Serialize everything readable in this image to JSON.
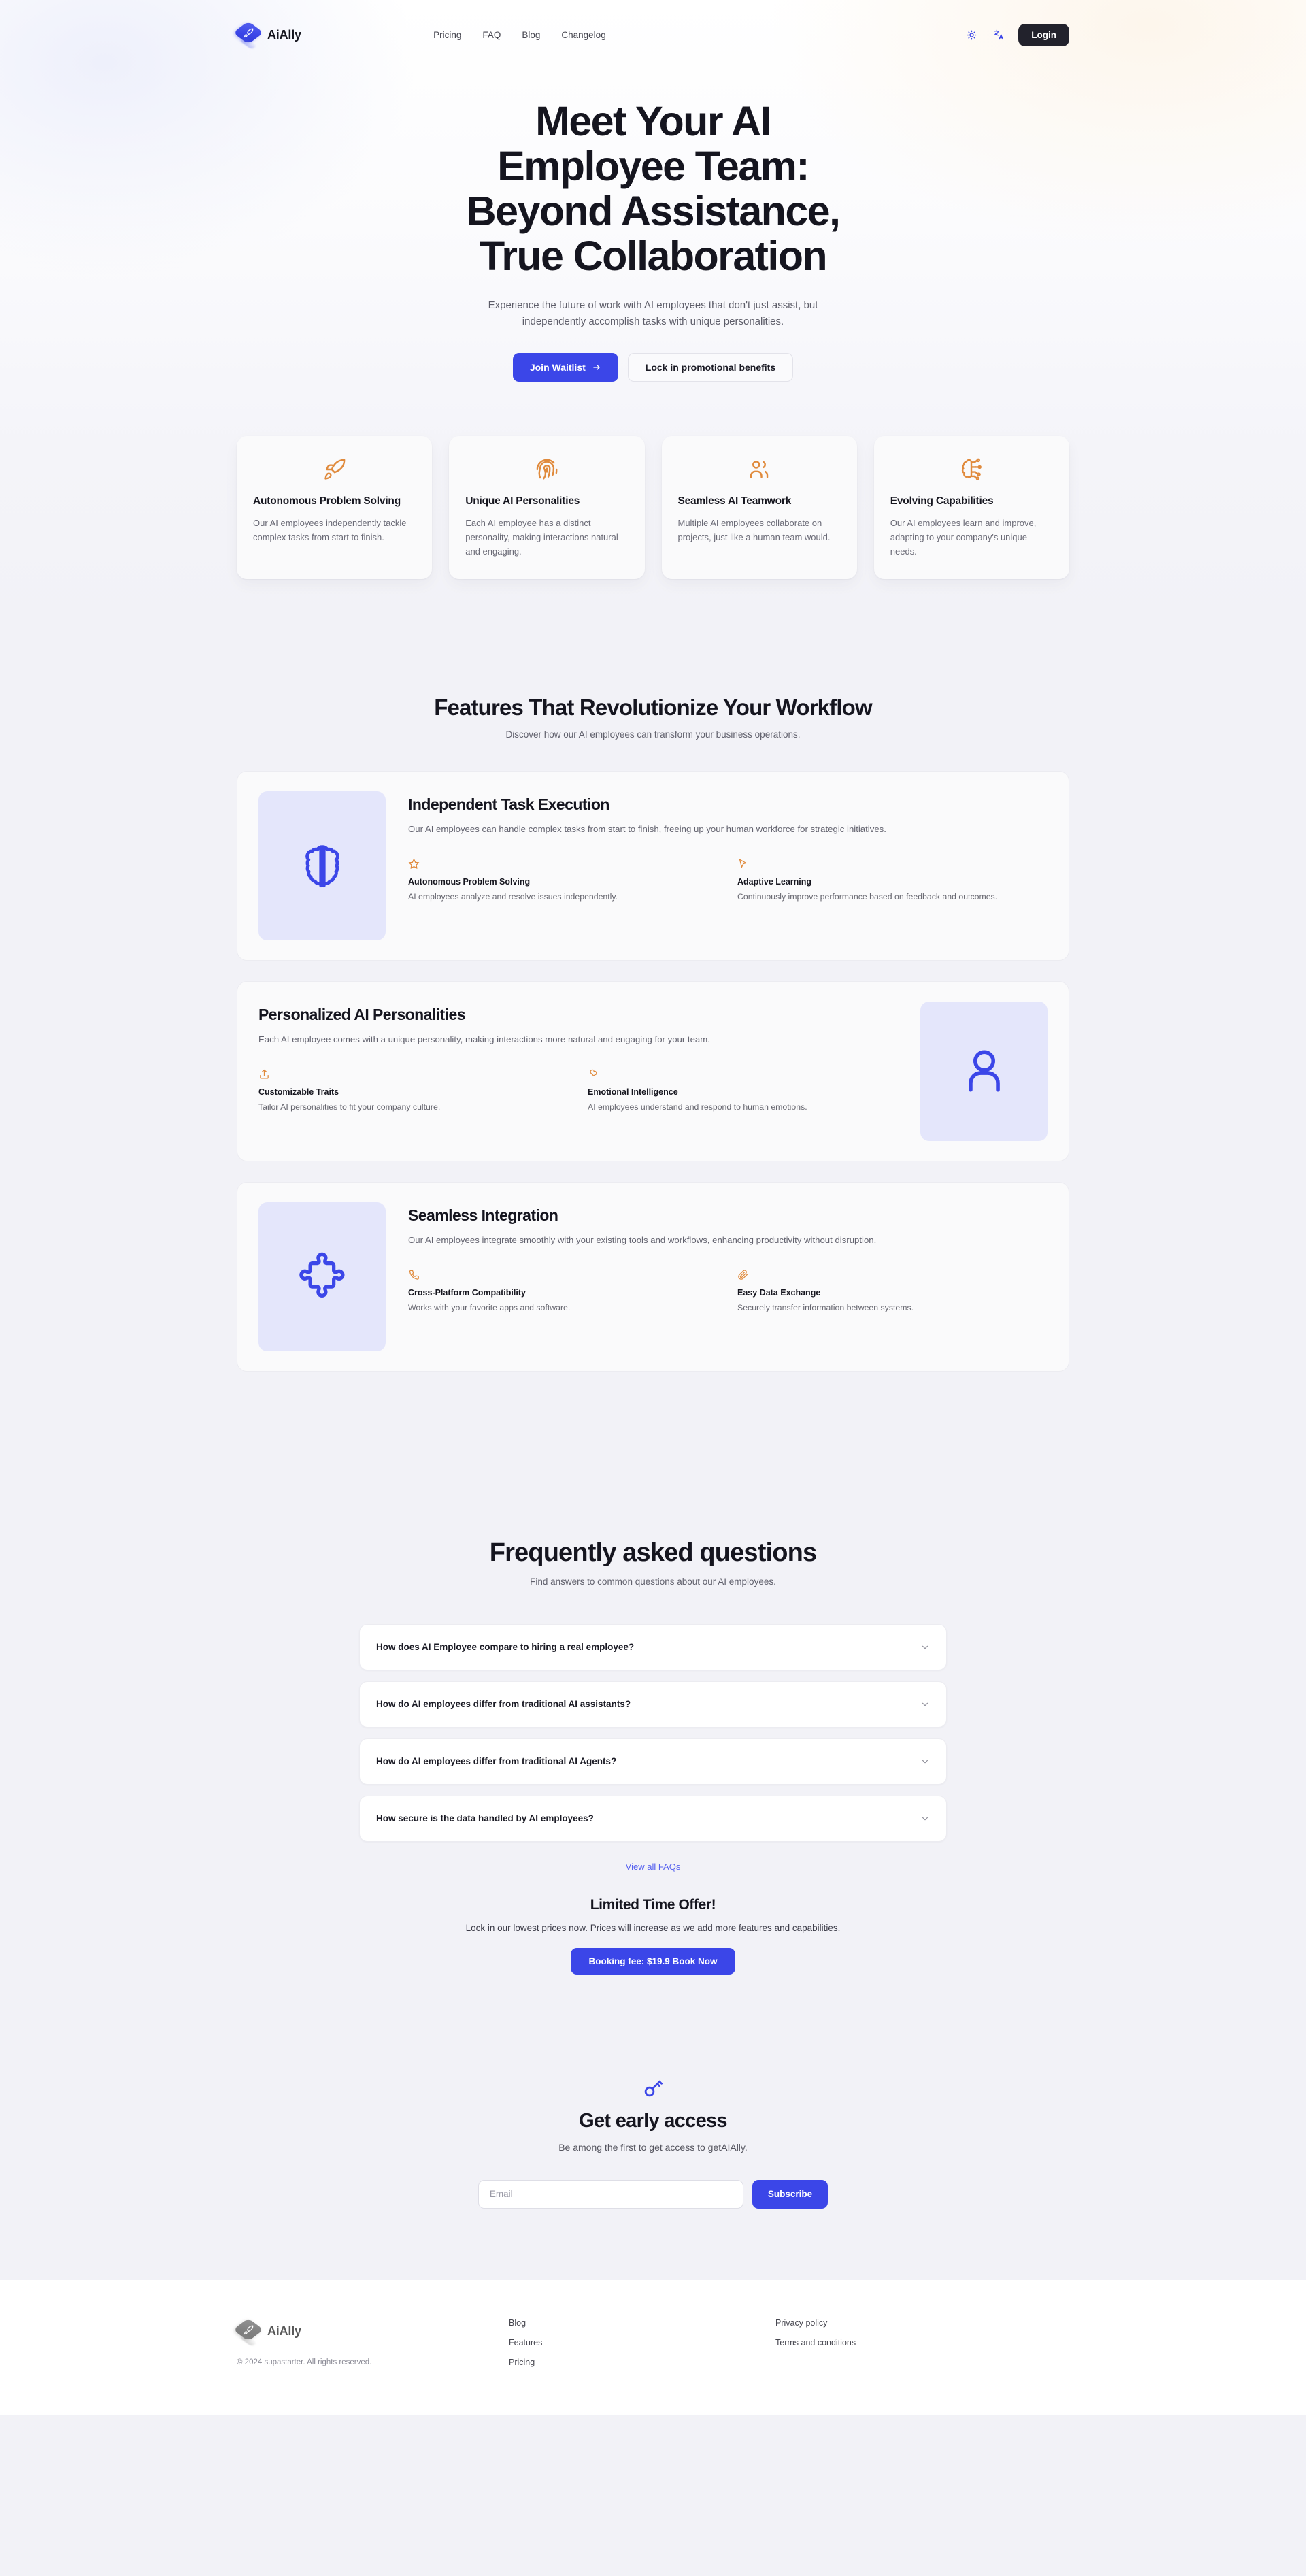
{
  "header": {
    "brand": "AiAlly",
    "logo_icon": "rocket-diamond-logo",
    "nav": [
      {
        "label": "Pricing"
      },
      {
        "label": "FAQ"
      },
      {
        "label": "Blog"
      },
      {
        "label": "Changelog"
      }
    ],
    "theme_toggle_icon": "sun-icon",
    "language_icon": "translate-icon",
    "login_label": "Login"
  },
  "hero": {
    "title_lines": [
      "Meet Your AI",
      "Employee Team:",
      "Beyond Assistance,",
      "True Collaboration"
    ],
    "subtitle": "Experience the future of work with AI employees that don't just assist, but independently accomplish tasks with unique personalities.",
    "primary_cta": "Join Waitlist",
    "primary_cta_icon": "arrow-right-icon",
    "secondary_cta": "Lock in promotional benefits"
  },
  "benefits": [
    {
      "icon": "rocket-icon",
      "title": "Autonomous Problem Solving",
      "desc": "Our AI employees independently tackle complex tasks from start to finish."
    },
    {
      "icon": "fingerprint-icon",
      "title": "Unique AI Personalities",
      "desc": "Each AI employee has a distinct personality, making interactions natural and engaging."
    },
    {
      "icon": "users-icon",
      "title": "Seamless AI Teamwork",
      "desc": "Multiple AI employees collaborate on projects, just like a human team would."
    },
    {
      "icon": "brain-circuit-icon",
      "title": "Evolving Capabilities",
      "desc": "Our AI employees learn and improve, adapting to your company's unique needs."
    }
  ],
  "features_section": {
    "title": "Features That Revolutionize Your Workflow",
    "subtitle": "Discover how our AI employees can transform your business operations.",
    "cards": [
      {
        "media_icon": "brain-icon",
        "title": "Independent Task Execution",
        "desc": "Our AI employees can handle complex tasks from start to finish, freeing up your human workforce for strategic initiatives.",
        "subs": [
          {
            "icon": "star-icon",
            "title": "Autonomous Problem Solving",
            "desc": "AI employees analyze and resolve issues independently."
          },
          {
            "icon": "cursor-icon",
            "title": "Adaptive Learning",
            "desc": "Continuously improve performance based on feedback and outcomes."
          }
        ]
      },
      {
        "media_icon": "user-icon",
        "title": "Personalized AI Personalities",
        "desc": "Each AI employee comes with a unique personality, making interactions more natural and engaging for your team.",
        "subs": [
          {
            "icon": "upload-icon",
            "title": "Customizable Traits",
            "desc": "Tailor AI personalities to fit your company culture."
          },
          {
            "icon": "heart-hand-icon",
            "title": "Emotional Intelligence",
            "desc": "AI employees understand and respond to human emotions."
          }
        ]
      },
      {
        "media_icon": "puzzle-icon",
        "title": "Seamless Integration",
        "desc": "Our AI employees integrate smoothly with your existing tools and workflows, enhancing productivity without disruption.",
        "subs": [
          {
            "icon": "phone-icon",
            "title": "Cross-Platform Compatibility",
            "desc": "Works with your favorite apps and software."
          },
          {
            "icon": "paperclip-icon",
            "title": "Easy Data Exchange",
            "desc": "Securely transfer information between systems."
          }
        ]
      }
    ]
  },
  "faq_section": {
    "title": "Frequently asked questions",
    "subtitle": "Find answers to common questions about our AI employees.",
    "items": [
      {
        "question": "How does AI Employee compare to hiring a real employee?",
        "chevron": "chevron-down-icon"
      },
      {
        "question": "How do AI employees differ from traditional AI assistants?",
        "chevron": "chevron-down-icon"
      },
      {
        "question": "How do AI employees differ from traditional AI Agents?",
        "chevron": "chevron-down-icon"
      },
      {
        "question": "How secure is the data handled by AI employees?",
        "chevron": "chevron-down-icon"
      }
    ],
    "view_all": "View all FAQs"
  },
  "offer": {
    "title": "Limited Time Offer!",
    "desc": "Lock in our lowest prices now. Prices will increase as we add more features and capabilities.",
    "cta": "Booking fee: $19.9 Book Now"
  },
  "early_access": {
    "icon": "key-icon",
    "title": "Get early access",
    "desc": "Be among the first to get access to getAIAlly.",
    "email_placeholder": "Email",
    "email_value": "",
    "subscribe_label": "Subscribe"
  },
  "footer": {
    "brand": "AiAlly",
    "copyright": "© 2024 supastarter. All rights reserved.",
    "col_a": [
      {
        "label": "Blog"
      },
      {
        "label": "Features"
      },
      {
        "label": "Pricing"
      }
    ],
    "col_b": [
      {
        "label": "Privacy policy"
      },
      {
        "label": "Terms and conditions"
      }
    ]
  },
  "colors": {
    "primary": "#3b46e8",
    "accent_orange": "#e08a3c",
    "dark": "#22222c",
    "page_bg": "#f2f2f7",
    "media_bg": "#e4e6fb"
  }
}
